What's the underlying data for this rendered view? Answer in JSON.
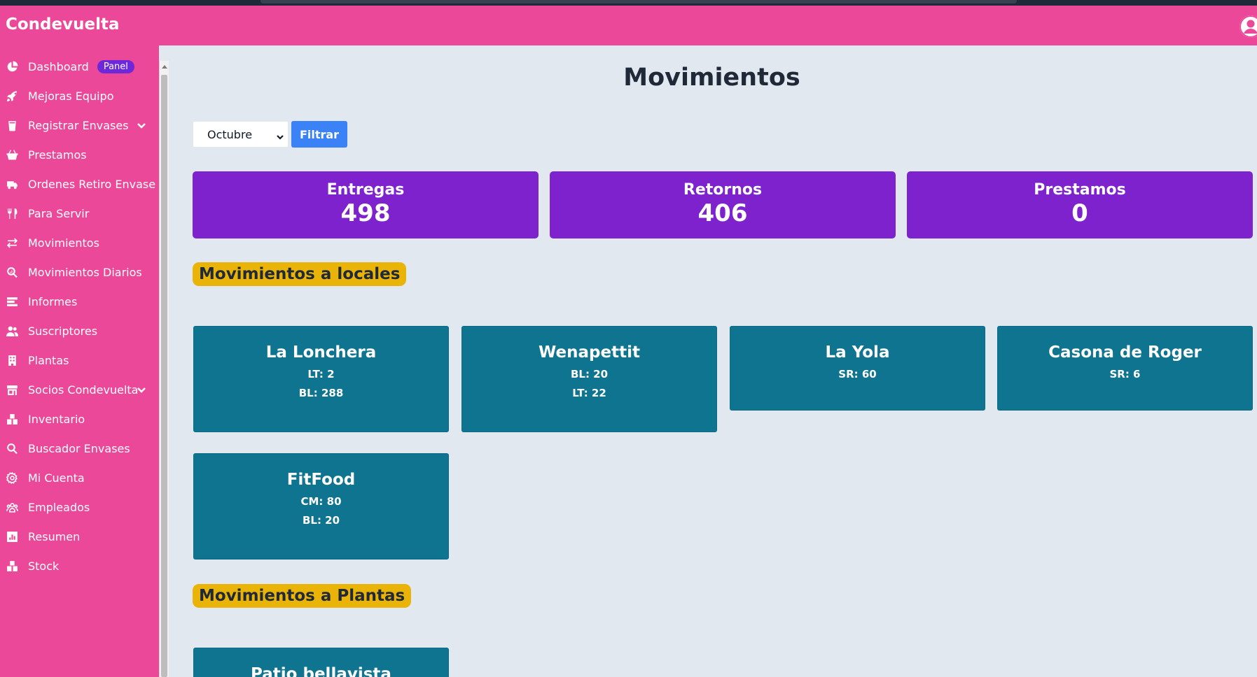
{
  "app": {
    "brand": "Condevuelta"
  },
  "sidebar": {
    "items": [
      {
        "label": "Dashboard",
        "icon": "chart-pie-icon",
        "badge": "Panel"
      },
      {
        "label": "Mejoras Equipo",
        "icon": "rocket-icon"
      },
      {
        "label": "Registrar Envases",
        "icon": "container-icon",
        "expandable": true
      },
      {
        "label": "Prestamos",
        "icon": "basket-icon"
      },
      {
        "label": "Ordenes Retiro Envase",
        "icon": "truck-icon"
      },
      {
        "label": "Para Servir",
        "icon": "utensils-icon"
      },
      {
        "label": "Movimientos",
        "icon": "arrows-exchange-icon"
      },
      {
        "label": "Movimientos Diarios",
        "icon": "search-chart-icon"
      },
      {
        "label": "Informes",
        "icon": "report-icon"
      },
      {
        "label": "Suscriptores",
        "icon": "users-icon"
      },
      {
        "label": "Plantas",
        "icon": "building-icon"
      },
      {
        "label": "Socios Condevuelta",
        "icon": "store-icon",
        "expandable": true
      },
      {
        "label": "Inventario",
        "icon": "boxes-icon"
      },
      {
        "label": "Buscador Envases",
        "icon": "search-icon"
      },
      {
        "label": "Mi Cuenta",
        "icon": "gear-icon"
      },
      {
        "label": "Empleados",
        "icon": "team-icon"
      },
      {
        "label": "Resumen",
        "icon": "square-chart-icon"
      },
      {
        "label": "Stock",
        "icon": "boxes-icon"
      }
    ]
  },
  "main": {
    "title": "Movimientos",
    "filter": {
      "month_selected": "Octubre",
      "button_label": "Filtrar"
    },
    "stats": [
      {
        "label": "Entregas",
        "value": "498"
      },
      {
        "label": "Retornos",
        "value": "406"
      },
      {
        "label": "Prestamos",
        "value": "0"
      }
    ],
    "section_locales": "Movimientos a locales",
    "locales": [
      {
        "name": "La Lonchera",
        "lines": [
          "LT: 2",
          "BL: 288"
        ]
      },
      {
        "name": "Wenapettit",
        "lines": [
          "BL: 20",
          "LT: 22"
        ]
      },
      {
        "name": "La Yola",
        "lines": [
          "SR: 60"
        ]
      },
      {
        "name": "Casona de Roger",
        "lines": [
          "SR: 6"
        ]
      },
      {
        "name": "FitFood",
        "lines": [
          "CM: 80",
          "BL: 20"
        ]
      }
    ],
    "section_plantas": "Movimientos a Plantas",
    "plantas": [
      {
        "name": "Patio bellavista"
      }
    ]
  },
  "colors": {
    "navbar": "#ec4899",
    "sidebar": "#ec4899",
    "background": "#e2e8f0",
    "stat_card": "#7e22ce",
    "badge": "#6d28d9",
    "section_tag": "#eab308",
    "local_card": "#0e7490",
    "filter_button": "#3b82f6"
  }
}
